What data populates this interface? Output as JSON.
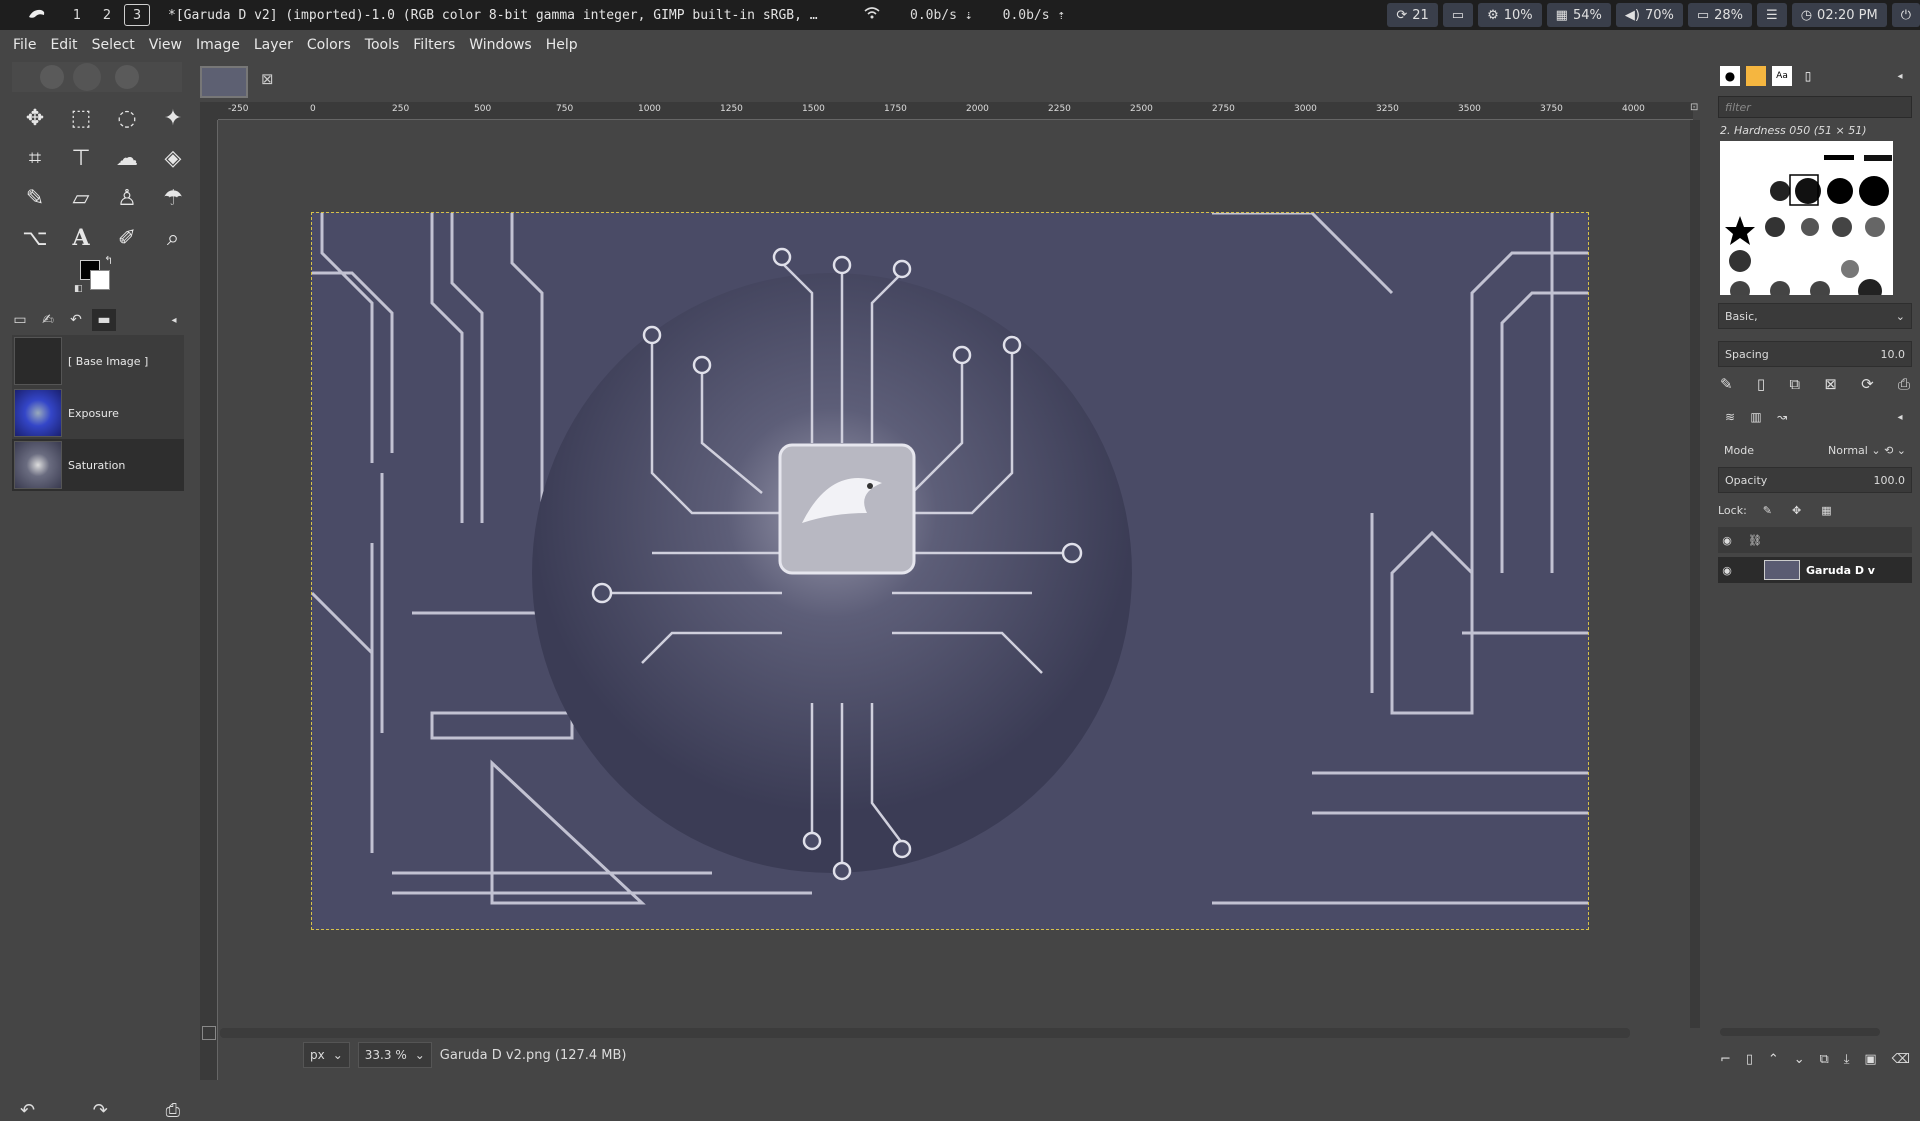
{
  "topbar": {
    "workspaces": [
      "1",
      "2",
      "3"
    ],
    "active_workspace": "3",
    "window_title": "*[Garuda D v2] (imported)-1.0 (RGB color 8-bit gamma integer, GIMP built-in sRGB, …",
    "net_down": "0.0b/s",
    "net_up": "0.0b/s",
    "updates": "21",
    "cpu": "10%",
    "mem": "54%",
    "volume": "70%",
    "battery": "28%",
    "clock": "02:20 PM"
  },
  "menu": [
    "File",
    "Edit",
    "Select",
    "View",
    "Image",
    "Layer",
    "Colors",
    "Tools",
    "Filters",
    "Windows",
    "Help"
  ],
  "layers_panel": {
    "items": [
      {
        "label": "[ Base Image ]"
      },
      {
        "label": "Exposure"
      },
      {
        "label": "Saturation"
      }
    ]
  },
  "ruler": {
    "h_ticks": [
      "-250",
      "0",
      "250",
      "500",
      "750",
      "1000",
      "1250",
      "1500",
      "1750",
      "2000",
      "2250",
      "2500",
      "2750",
      "3000",
      "3250",
      "3500",
      "3750",
      "4000"
    ]
  },
  "statusbar": {
    "unit": "px",
    "zoom": "33.3 %",
    "file_info": "Garuda D v2.png (127.4 MB)"
  },
  "brushes": {
    "filter_placeholder": "filter",
    "brush_name": "2. Hardness 050 (51 × 51)",
    "preset": "Basic,",
    "spacing_label": "Spacing",
    "spacing_value": "10.0"
  },
  "layers_dock": {
    "mode_label": "Mode",
    "mode_value": "Normal",
    "opacity_label": "Opacity",
    "opacity_value": "100.0",
    "lock_label": "Lock:",
    "layer_name": "Garuda D v"
  },
  "colors": {
    "accent": "#d7c24a",
    "art_bg": "#4a4b66",
    "circuit": "#c8c8d6"
  }
}
